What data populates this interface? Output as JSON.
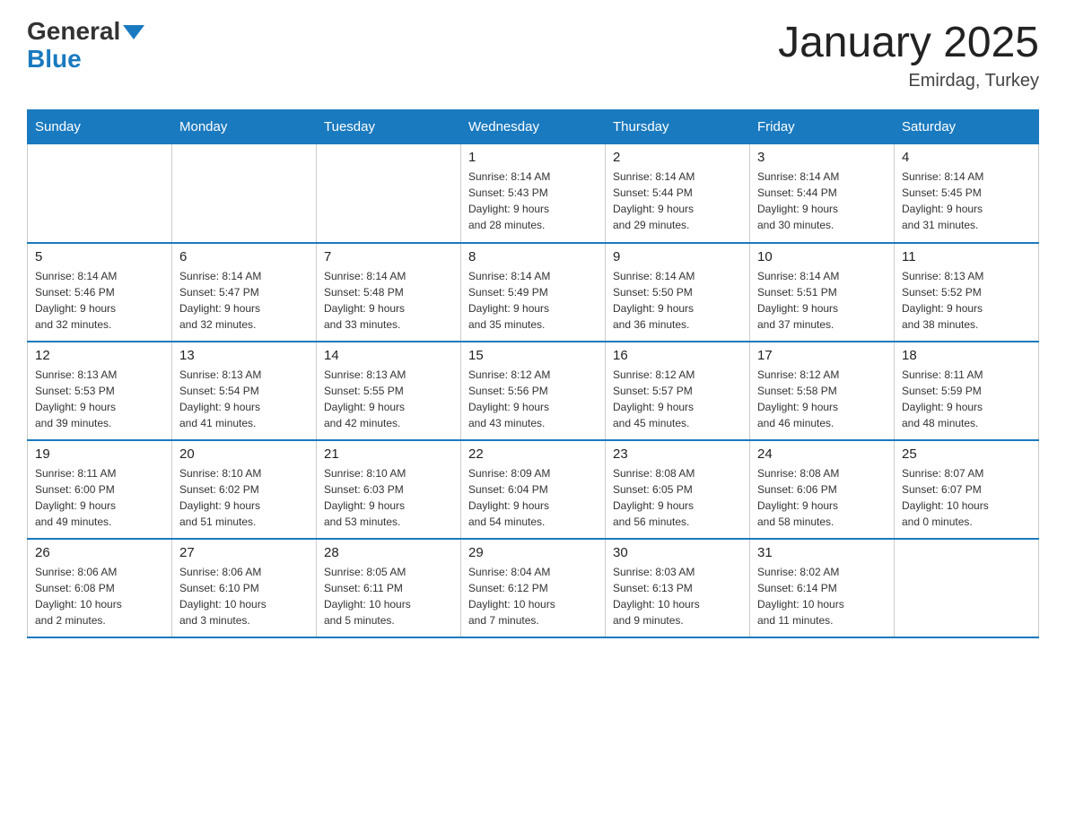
{
  "header": {
    "logo_general": "General",
    "logo_blue": "Blue",
    "title": "January 2025",
    "subtitle": "Emirdag, Turkey"
  },
  "days_of_week": [
    "Sunday",
    "Monday",
    "Tuesday",
    "Wednesday",
    "Thursday",
    "Friday",
    "Saturday"
  ],
  "weeks": [
    [
      {
        "day": "",
        "info": ""
      },
      {
        "day": "",
        "info": ""
      },
      {
        "day": "",
        "info": ""
      },
      {
        "day": "1",
        "info": "Sunrise: 8:14 AM\nSunset: 5:43 PM\nDaylight: 9 hours\nand 28 minutes."
      },
      {
        "day": "2",
        "info": "Sunrise: 8:14 AM\nSunset: 5:44 PM\nDaylight: 9 hours\nand 29 minutes."
      },
      {
        "day": "3",
        "info": "Sunrise: 8:14 AM\nSunset: 5:44 PM\nDaylight: 9 hours\nand 30 minutes."
      },
      {
        "day": "4",
        "info": "Sunrise: 8:14 AM\nSunset: 5:45 PM\nDaylight: 9 hours\nand 31 minutes."
      }
    ],
    [
      {
        "day": "5",
        "info": "Sunrise: 8:14 AM\nSunset: 5:46 PM\nDaylight: 9 hours\nand 32 minutes."
      },
      {
        "day": "6",
        "info": "Sunrise: 8:14 AM\nSunset: 5:47 PM\nDaylight: 9 hours\nand 32 minutes."
      },
      {
        "day": "7",
        "info": "Sunrise: 8:14 AM\nSunset: 5:48 PM\nDaylight: 9 hours\nand 33 minutes."
      },
      {
        "day": "8",
        "info": "Sunrise: 8:14 AM\nSunset: 5:49 PM\nDaylight: 9 hours\nand 35 minutes."
      },
      {
        "day": "9",
        "info": "Sunrise: 8:14 AM\nSunset: 5:50 PM\nDaylight: 9 hours\nand 36 minutes."
      },
      {
        "day": "10",
        "info": "Sunrise: 8:14 AM\nSunset: 5:51 PM\nDaylight: 9 hours\nand 37 minutes."
      },
      {
        "day": "11",
        "info": "Sunrise: 8:13 AM\nSunset: 5:52 PM\nDaylight: 9 hours\nand 38 minutes."
      }
    ],
    [
      {
        "day": "12",
        "info": "Sunrise: 8:13 AM\nSunset: 5:53 PM\nDaylight: 9 hours\nand 39 minutes."
      },
      {
        "day": "13",
        "info": "Sunrise: 8:13 AM\nSunset: 5:54 PM\nDaylight: 9 hours\nand 41 minutes."
      },
      {
        "day": "14",
        "info": "Sunrise: 8:13 AM\nSunset: 5:55 PM\nDaylight: 9 hours\nand 42 minutes."
      },
      {
        "day": "15",
        "info": "Sunrise: 8:12 AM\nSunset: 5:56 PM\nDaylight: 9 hours\nand 43 minutes."
      },
      {
        "day": "16",
        "info": "Sunrise: 8:12 AM\nSunset: 5:57 PM\nDaylight: 9 hours\nand 45 minutes."
      },
      {
        "day": "17",
        "info": "Sunrise: 8:12 AM\nSunset: 5:58 PM\nDaylight: 9 hours\nand 46 minutes."
      },
      {
        "day": "18",
        "info": "Sunrise: 8:11 AM\nSunset: 5:59 PM\nDaylight: 9 hours\nand 48 minutes."
      }
    ],
    [
      {
        "day": "19",
        "info": "Sunrise: 8:11 AM\nSunset: 6:00 PM\nDaylight: 9 hours\nand 49 minutes."
      },
      {
        "day": "20",
        "info": "Sunrise: 8:10 AM\nSunset: 6:02 PM\nDaylight: 9 hours\nand 51 minutes."
      },
      {
        "day": "21",
        "info": "Sunrise: 8:10 AM\nSunset: 6:03 PM\nDaylight: 9 hours\nand 53 minutes."
      },
      {
        "day": "22",
        "info": "Sunrise: 8:09 AM\nSunset: 6:04 PM\nDaylight: 9 hours\nand 54 minutes."
      },
      {
        "day": "23",
        "info": "Sunrise: 8:08 AM\nSunset: 6:05 PM\nDaylight: 9 hours\nand 56 minutes."
      },
      {
        "day": "24",
        "info": "Sunrise: 8:08 AM\nSunset: 6:06 PM\nDaylight: 9 hours\nand 58 minutes."
      },
      {
        "day": "25",
        "info": "Sunrise: 8:07 AM\nSunset: 6:07 PM\nDaylight: 10 hours\nand 0 minutes."
      }
    ],
    [
      {
        "day": "26",
        "info": "Sunrise: 8:06 AM\nSunset: 6:08 PM\nDaylight: 10 hours\nand 2 minutes."
      },
      {
        "day": "27",
        "info": "Sunrise: 8:06 AM\nSunset: 6:10 PM\nDaylight: 10 hours\nand 3 minutes."
      },
      {
        "day": "28",
        "info": "Sunrise: 8:05 AM\nSunset: 6:11 PM\nDaylight: 10 hours\nand 5 minutes."
      },
      {
        "day": "29",
        "info": "Sunrise: 8:04 AM\nSunset: 6:12 PM\nDaylight: 10 hours\nand 7 minutes."
      },
      {
        "day": "30",
        "info": "Sunrise: 8:03 AM\nSunset: 6:13 PM\nDaylight: 10 hours\nand 9 minutes."
      },
      {
        "day": "31",
        "info": "Sunrise: 8:02 AM\nSunset: 6:14 PM\nDaylight: 10 hours\nand 11 minutes."
      },
      {
        "day": "",
        "info": ""
      }
    ]
  ]
}
